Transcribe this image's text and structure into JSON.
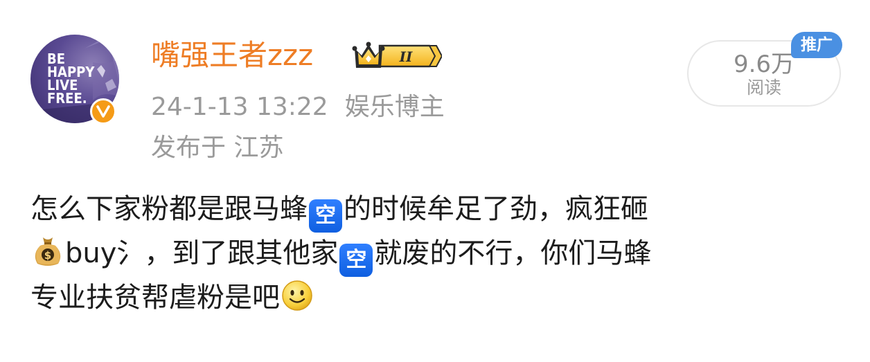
{
  "author": {
    "avatar_lines": [
      "BE",
      "HAPPY",
      "LIVE",
      "FREE."
    ],
    "verified_icon": "verified-v-badge",
    "name": "嘴强王者zzz",
    "level_badge": "II",
    "name_color": "#ee7d25"
  },
  "meta": {
    "time": "24-1-13 13:22",
    "tag": "娱乐博主",
    "location": "发布于 江苏"
  },
  "stats": {
    "views": "9.6万",
    "views_label": "阅读",
    "promo": "推广"
  },
  "post": {
    "line1_a": "怎么下家粉都是跟马蜂",
    "line1_b": "的时候牟足了劲，疯狂砸",
    "line2_a": "buy氵，到了跟其他家",
    "line2_b": "就废的不行，你们马蜂",
    "line3": "专业扶贫帮虐粉是吧",
    "kong_label": "空",
    "money_emoji": "money-bag-icon",
    "smile_emoji": "smile-icon"
  },
  "colors": {
    "accent_orange": "#ee7d25",
    "promo_blue": "#4a90e2",
    "meta_gray": "#9a9a9a"
  }
}
